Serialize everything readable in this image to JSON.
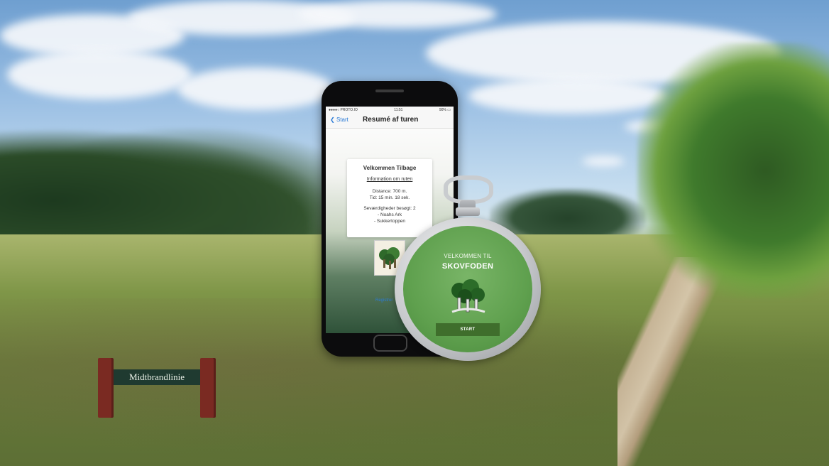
{
  "sign": {
    "text": "Midtbrandlinie"
  },
  "phone": {
    "status": {
      "carrier": "●●●●○ PROTO.IO",
      "time": "11:51",
      "battery": "90% ▭"
    },
    "nav": {
      "back_label": "Start",
      "title": "Resumé af turen"
    },
    "card": {
      "welcome": "Velkommen Tilbage",
      "info_link": "Information om ruten",
      "distance": "Distance: 700 m.",
      "time": "Tid: 15 min. 18 sek.",
      "sights_label": "Seværdigheder besøgt: 2",
      "sight_1": "- Noahs Ark",
      "sight_2": "- Sukkertoppen"
    },
    "logo_icon": "skovfoden-tree-logo",
    "bottom_link": "Registrer"
  },
  "watch": {
    "label": "VELKOMMEN TIL",
    "title": "SKOVFODEN",
    "logo_icon": "tree-logo",
    "start_label": "START"
  }
}
